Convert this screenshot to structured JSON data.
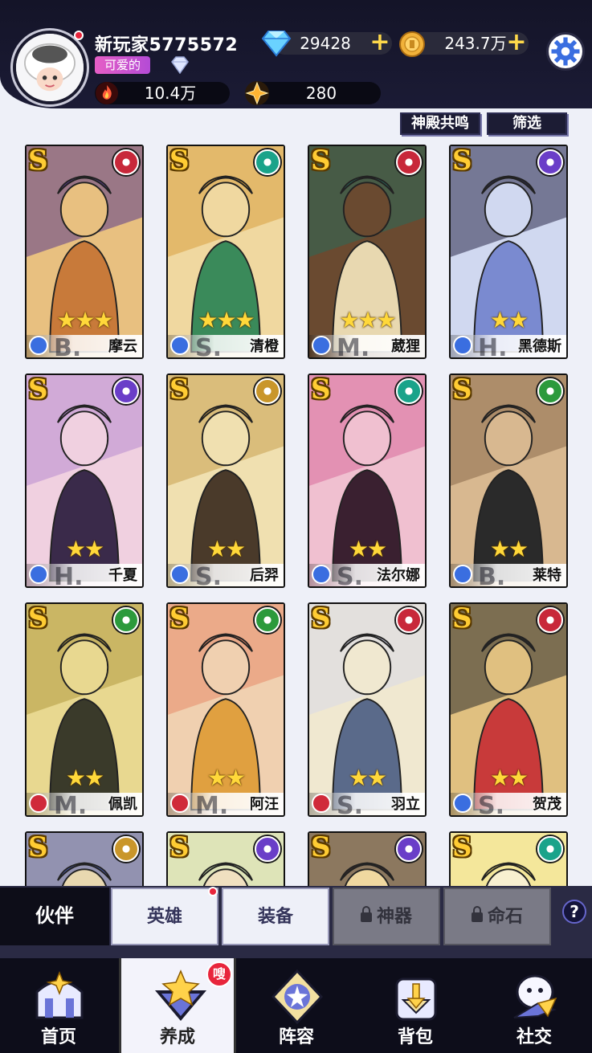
{
  "player": {
    "name": "新玩家5775572",
    "title": "可爱的",
    "power": "10.4万",
    "energy": "280"
  },
  "currency": {
    "diamonds": "29428",
    "gold": "243.7万"
  },
  "toolbar": {
    "resonance": "神殿共鸣",
    "filter": "筛选"
  },
  "heroes": [
    {
      "name": "摩云",
      "rarity": "S",
      "stars": "★★★",
      "element": "fire",
      "class_letter": "B.",
      "class": "sword"
    },
    {
      "name": "清橙",
      "rarity": "S",
      "stars": "★★★",
      "element": "wind",
      "class_letter": "S.",
      "class": "heart"
    },
    {
      "name": "葳狸",
      "rarity": "S",
      "stars": "★★★",
      "element": "fire",
      "class_letter": "M.",
      "class": "heart"
    },
    {
      "name": "黑德斯",
      "rarity": "S",
      "stars": "★★",
      "element": "moon",
      "class_letter": "H.",
      "class": "sword"
    },
    {
      "name": "千夏",
      "rarity": "S",
      "stars": "★★",
      "element": "moon",
      "class_letter": "H.",
      "class": "sword"
    },
    {
      "name": "后羿",
      "rarity": "S",
      "stars": "★★",
      "element": "light",
      "class_letter": "S.",
      "class": "bow"
    },
    {
      "name": "法尔娜",
      "rarity": "S",
      "stars": "★★",
      "element": "wind",
      "class_letter": "S.",
      "class": "bow"
    },
    {
      "name": "莱特",
      "rarity": "S",
      "stars": "★★",
      "element": "nature",
      "class_letter": "B.",
      "class": "bow"
    },
    {
      "name": "佩凯",
      "rarity": "S",
      "stars": "★★",
      "element": "nature",
      "class_letter": "M.",
      "class": "shield"
    },
    {
      "name": "阿汪",
      "rarity": "S",
      "stars": "★★",
      "element": "nature",
      "class_letter": "M.",
      "class": "shield"
    },
    {
      "name": "羽立",
      "rarity": "S",
      "stars": "★★",
      "element": "fire",
      "class_letter": "S.",
      "class": "shield"
    },
    {
      "name": "贺茂",
      "rarity": "S",
      "stars": "★★",
      "element": "fire",
      "class_letter": "S.",
      "class": "sword"
    },
    {
      "name": "",
      "rarity": "S",
      "stars": "",
      "element": "light",
      "class_letter": "",
      "class": ""
    },
    {
      "name": "",
      "rarity": "S",
      "stars": "",
      "element": "moon",
      "class_letter": "",
      "class": ""
    },
    {
      "name": "",
      "rarity": "S",
      "stars": "",
      "element": "moon",
      "class_letter": "",
      "class": ""
    },
    {
      "name": "",
      "rarity": "S",
      "stars": "",
      "element": "wind",
      "class_letter": "",
      "class": ""
    }
  ],
  "tabs": [
    {
      "label": "伙伴",
      "state": "active"
    },
    {
      "label": "英雄",
      "state": "normal"
    },
    {
      "label": "装备",
      "state": "normal"
    },
    {
      "label": "神器",
      "state": "locked"
    },
    {
      "label": "命石",
      "state": "locked"
    }
  ],
  "help_label": "?",
  "nav": [
    {
      "label": "首页",
      "icon": "home-icon"
    },
    {
      "label": "养成",
      "icon": "develop-icon",
      "badge": "嗖"
    },
    {
      "label": "阵容",
      "icon": "formation-icon"
    },
    {
      "label": "背包",
      "icon": "backpack-icon"
    },
    {
      "label": "社交",
      "icon": "social-icon"
    }
  ],
  "colors": {
    "fire": "#c8283a",
    "wind": "#1aa38a",
    "moon": "#6a3ec8",
    "light": "#c9962a",
    "nature": "#2c9a3c",
    "sword": "#3a6ee0",
    "heart": "#3a6ee0",
    "bow": "#3a6ee0",
    "shield": "#d02a3a"
  }
}
